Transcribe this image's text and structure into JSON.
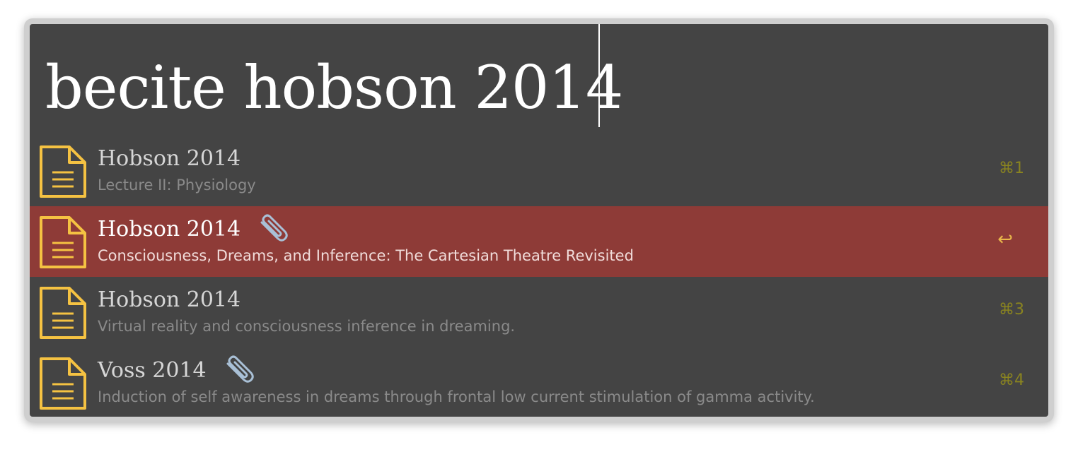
{
  "query": {
    "text": "becite hobson 2014"
  },
  "colors": {
    "panel_background": "#444444",
    "selected_row": "#8e3b37",
    "document_icon": "#f5c242",
    "shortcut_text": "#8a8420"
  },
  "results": [
    {
      "icon": "document-icon",
      "title": "Hobson 2014",
      "subtitle": "Lecture II: Physiology",
      "attachment": false,
      "shortcut": "⌘1",
      "selected": false
    },
    {
      "icon": "document-icon",
      "title": "Hobson 2014",
      "subtitle": "Consciousness, Dreams, and Inference: The Cartesian Theatre Revisited",
      "attachment": true,
      "attachment_icon": "paperclip-icon",
      "shortcut": "↩",
      "selected": true
    },
    {
      "icon": "document-icon",
      "title": "Hobson 2014",
      "subtitle": "Virtual reality and consciousness inference in dreaming.",
      "attachment": false,
      "shortcut": "⌘3",
      "selected": false
    },
    {
      "icon": "document-icon",
      "title": "Voss 2014",
      "subtitle": "Induction of self awareness in dreams through frontal low current stimulation of gamma activity.",
      "attachment": true,
      "attachment_icon": "paperclip-icon",
      "shortcut": "⌘4",
      "selected": false
    }
  ]
}
